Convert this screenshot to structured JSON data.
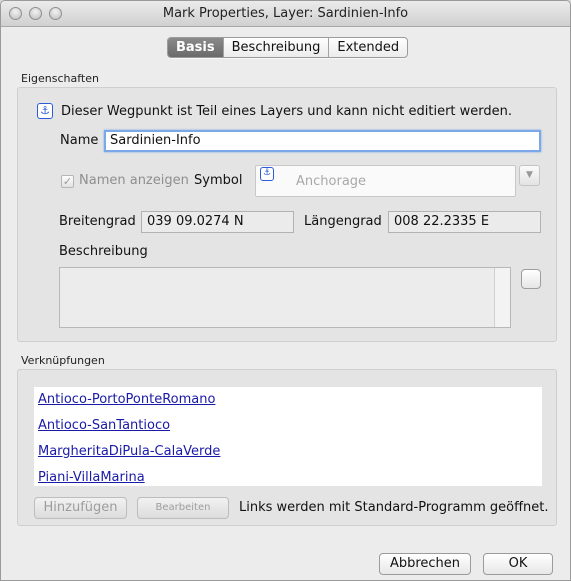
{
  "window": {
    "title": "Mark Properties, Layer: Sardinien-Info"
  },
  "tabs": [
    {
      "label": "Basis",
      "active": true
    },
    {
      "label": "Beschreibung",
      "active": false
    },
    {
      "label": "Extended",
      "active": false
    }
  ],
  "properties": {
    "section_label": "Eigenschaften",
    "info_text": "Dieser Wegpunkt ist Teil eines Layers und kann nicht editiert werden.",
    "name_label": "Name",
    "name_value": "Sardinien-Info",
    "show_name_label": "Namen anzeigen",
    "show_name_checked": true,
    "symbol_label": "Symbol",
    "symbol_value": "Anchorage",
    "lat_label": "Breitengrad",
    "lat_value": "039 09.0274 N",
    "lon_label": "Längengrad",
    "lon_value": "008 22.2335 E",
    "description_label": "Beschreibung",
    "description_value": ""
  },
  "links": {
    "section_label": "Verknüpfungen",
    "items": [
      "Antioco-PortoPonteRomano",
      "Antioco-SanTantioco",
      "MargheritaDiPula-CalaVerde",
      "Piani-VillaMarina"
    ],
    "add_label": "Hinzufügen",
    "edit_label": "Bearbeiten",
    "note": "Links werden mit Standard-Programm geöffnet."
  },
  "footer": {
    "cancel_label": "Abbrechen",
    "ok_label": "OK"
  },
  "icons": {
    "info": "anchor-icon",
    "symbol": "anchor-icon",
    "dropdown": "chevron-down-icon"
  }
}
